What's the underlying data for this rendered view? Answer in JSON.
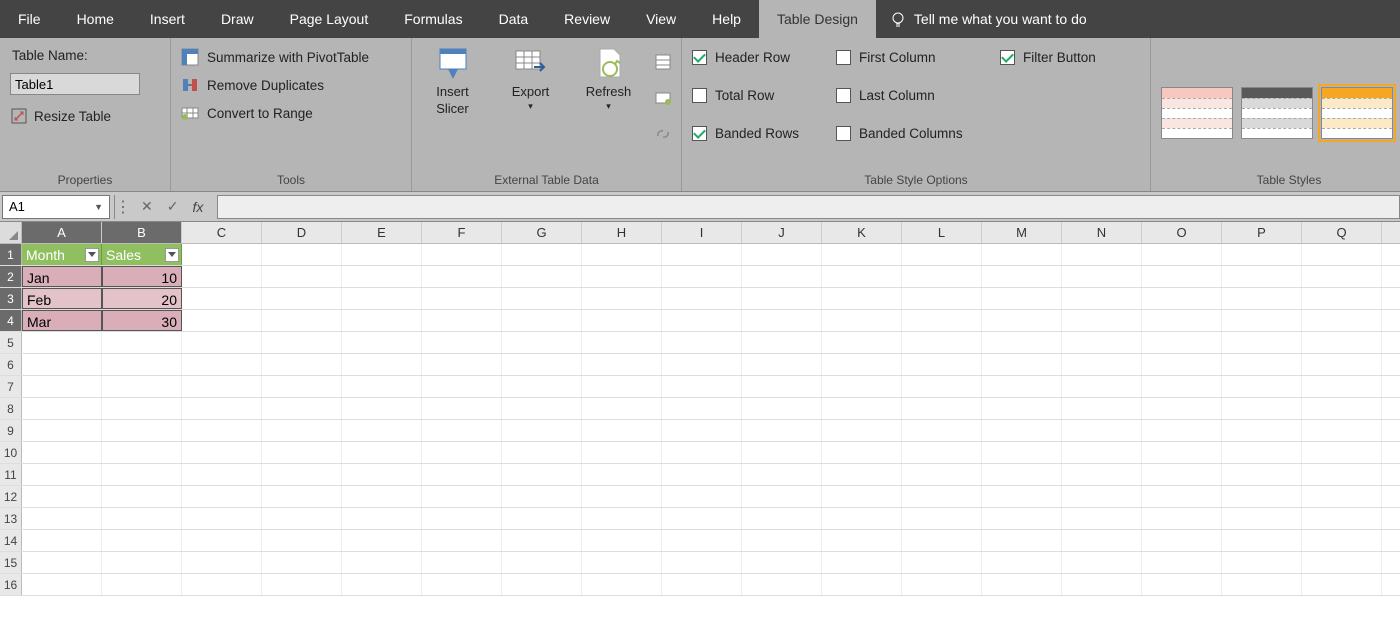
{
  "tabs": [
    "File",
    "Home",
    "Insert",
    "Draw",
    "Page Layout",
    "Formulas",
    "Data",
    "Review",
    "View",
    "Help",
    "Table Design"
  ],
  "active_tab_index": 10,
  "tellme": "Tell me what you want to do",
  "properties": {
    "label": "Table Name:",
    "table_name": "Table1",
    "resize": "Resize Table",
    "group": "Properties"
  },
  "tools": {
    "pivot": "Summarize with PivotTable",
    "dupes": "Remove Duplicates",
    "range": "Convert to Range",
    "group": "Tools"
  },
  "ext": {
    "slicer": "Insert Slicer",
    "slicer_l1": "Insert",
    "slicer_l2": "Slicer",
    "export": "Export",
    "refresh": "Refresh",
    "group": "External Table Data"
  },
  "opts": {
    "header": "Header Row",
    "total": "Total Row",
    "banded_rows": "Banded Rows",
    "first_col": "First Column",
    "last_col": "Last Column",
    "banded_cols": "Banded Columns",
    "filter": "Filter Button",
    "group": "Table Style Options"
  },
  "styles_group": "Table Styles",
  "name_box": "A1",
  "columns": [
    "A",
    "B",
    "C",
    "D",
    "E",
    "F",
    "G",
    "H",
    "I",
    "J",
    "K",
    "L",
    "M",
    "N",
    "O",
    "P",
    "Q"
  ],
  "table": {
    "headers": [
      "Month",
      "Sales"
    ],
    "rows": [
      {
        "month": "Jan",
        "sales": "10"
      },
      {
        "month": "Feb",
        "sales": "20"
      },
      {
        "month": "Mar",
        "sales": "30"
      }
    ]
  },
  "row_count": 16
}
